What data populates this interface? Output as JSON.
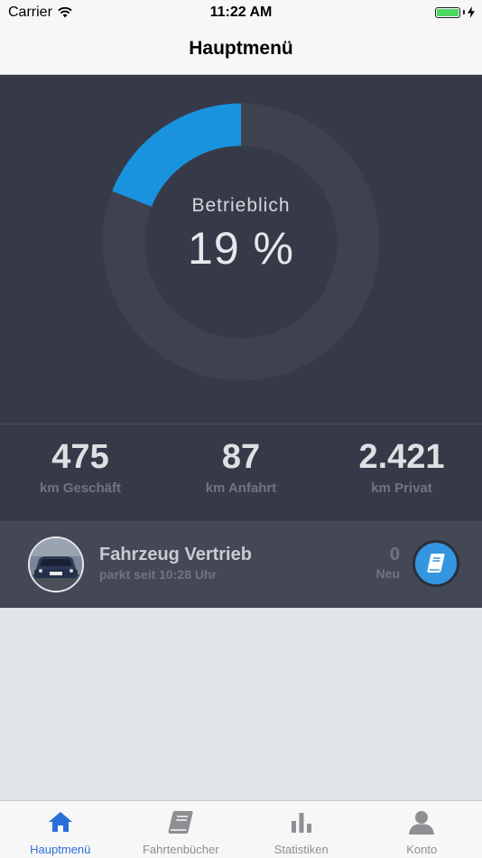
{
  "status_bar": {
    "carrier": "Carrier",
    "time": "11:22 AM"
  },
  "nav": {
    "title": "Hauptmenü"
  },
  "gauge": {
    "label": "Betrieblich",
    "value_text": "19 %",
    "percent": 19,
    "track_color": "#3e4250",
    "fill_color": "#1a93de"
  },
  "stats": [
    {
      "value": "475",
      "label": "km Geschäft"
    },
    {
      "value": "87",
      "label": "km Anfahrt"
    },
    {
      "value": "2.421",
      "label": "km Privat"
    }
  ],
  "vehicle": {
    "name": "Fahrzeug Vertrieb",
    "status": "parkt seit 10:28 Uhr",
    "count": "0",
    "count_label": "Neu",
    "button_icon": "logbook-icon"
  },
  "tabbar": {
    "active_color": "#2a6fd9",
    "items": [
      {
        "label": "Hauptmenü",
        "icon": "home-icon"
      },
      {
        "label": "Fahrtenbücher",
        "icon": "book-icon"
      },
      {
        "label": "Statistiken",
        "icon": "bar-chart-icon"
      },
      {
        "label": "Konto",
        "icon": "person-icon"
      }
    ]
  }
}
